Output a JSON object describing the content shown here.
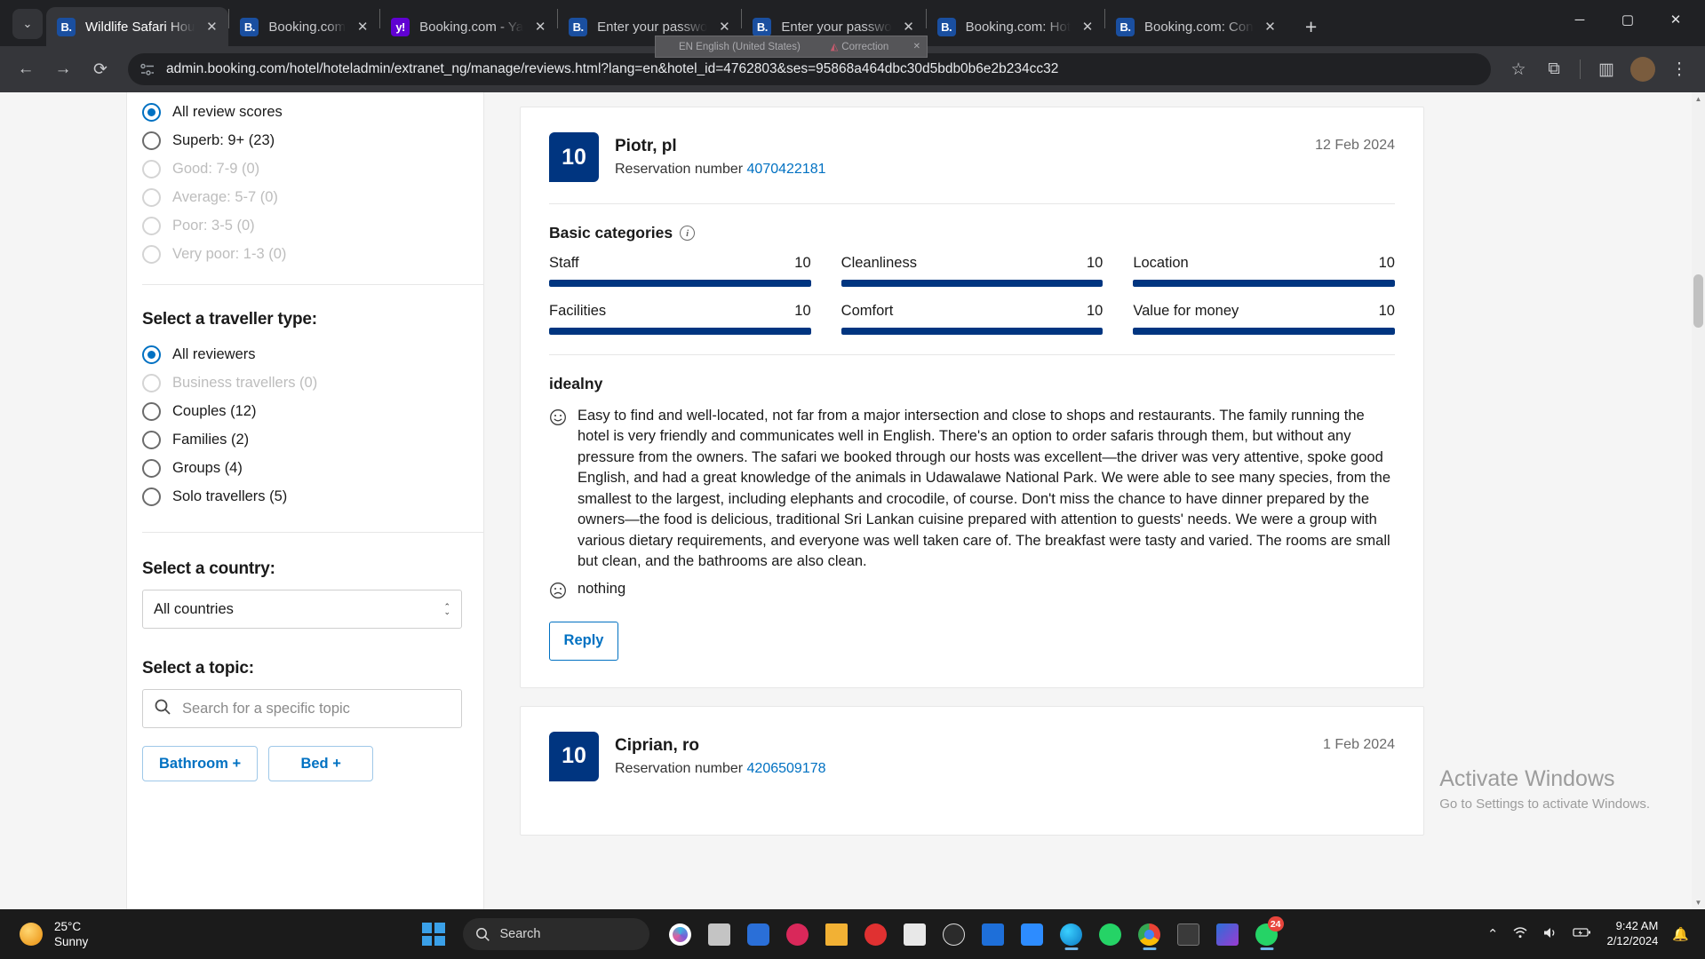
{
  "browser": {
    "tabs": [
      {
        "title": "Wildlife Safari Hou",
        "favicon": "B.",
        "active": true
      },
      {
        "title": "Booking.com",
        "favicon": "B.",
        "active": false
      },
      {
        "title": "Booking.com - Ya",
        "favicon": "y!",
        "active": false,
        "brand": "yahoo"
      },
      {
        "title": "Enter your passwo",
        "favicon": "B.",
        "active": false
      },
      {
        "title": "Enter your passwo",
        "favicon": "B.",
        "active": false
      },
      {
        "title": "Booking.com: Hot",
        "favicon": "B.",
        "active": false
      },
      {
        "title": "Booking.com: Con",
        "favicon": "B.",
        "active": false
      }
    ],
    "new_tab_label": "+",
    "tab_list_label": "⌄",
    "window_controls": {
      "minimize": "─",
      "maximize": "▢",
      "close": "✕"
    },
    "nav": {
      "back": "←",
      "forward": "→",
      "reload": "⟳"
    },
    "url": "admin.booking.com/hotel/hoteladmin/extranet_ng/manage/reviews.html?lang=en&hotel_id=4762803&ses=95868a464dbc30d5bdb0b6e2b234cc32",
    "bookmark_icon": "☆",
    "extensions_icon": "⧉",
    "sidepanel_icon": "▥",
    "profile_initial": "",
    "menu_icon": "⋮"
  },
  "ime_popup": {
    "language": "EN English (United States)",
    "correction": "Correction",
    "close": "✕"
  },
  "sidebar": {
    "review_scores": {
      "options": [
        {
          "label": "All review scores",
          "checked": true,
          "disabled": false
        },
        {
          "label": "Superb: 9+ (23)",
          "checked": false,
          "disabled": false
        },
        {
          "label": "Good: 7-9 (0)",
          "checked": false,
          "disabled": true
        },
        {
          "label": "Average: 5-7 (0)",
          "checked": false,
          "disabled": true
        },
        {
          "label": "Poor: 3-5 (0)",
          "checked": false,
          "disabled": true
        },
        {
          "label": "Very poor: 1-3 (0)",
          "checked": false,
          "disabled": true
        }
      ]
    },
    "traveller_type": {
      "title": "Select a traveller type:",
      "options": [
        {
          "label": "All reviewers",
          "checked": true,
          "disabled": false
        },
        {
          "label": "Business travellers (0)",
          "checked": false,
          "disabled": true
        },
        {
          "label": "Couples (12)",
          "checked": false,
          "disabled": false
        },
        {
          "label": "Families (2)",
          "checked": false,
          "disabled": false
        },
        {
          "label": "Groups (4)",
          "checked": false,
          "disabled": false
        },
        {
          "label": "Solo travellers (5)",
          "checked": false,
          "disabled": false
        }
      ]
    },
    "country": {
      "title": "Select a country:",
      "selected": "All countries"
    },
    "topic": {
      "title": "Select a topic:",
      "search_placeholder": "Search for a specific topic",
      "chips": [
        "Bathroom +",
        "Bed +"
      ]
    }
  },
  "reviews": [
    {
      "score": "10",
      "name": "Piotr, pl",
      "reservation_label": "Reservation number",
      "reservation_number": "4070422181",
      "date": "12 Feb 2024",
      "categories_title": "Basic categories",
      "categories": [
        {
          "name": "Staff",
          "value": "10",
          "pct": 100
        },
        {
          "name": "Cleanliness",
          "value": "10",
          "pct": 100
        },
        {
          "name": "Location",
          "value": "10",
          "pct": 100
        },
        {
          "name": "Facilities",
          "value": "10",
          "pct": 100
        },
        {
          "name": "Comfort",
          "value": "10",
          "pct": 100
        },
        {
          "name": "Value for money",
          "value": "10",
          "pct": 100
        }
      ],
      "title": "idealny",
      "positive": "Easy to find and well-located, not far from a major intersection and close to shops and restaurants. The family running the hotel is very friendly and communicates well in English. There's an option to order safaris through them, but without any pressure from the owners. The safari we booked through our hosts was excellent—the driver was very attentive, spoke good English, and had a great knowledge of the animals in Udawalawe National Park. We were able to see many species, from the smallest to the largest, including elephants and crocodile, of course. Don't miss the chance to have dinner prepared by the owners—the food is delicious, traditional Sri Lankan cuisine prepared with attention to guests' needs. We were a group with various dietary requirements, and everyone was well taken care of. The breakfast were tasty and varied. The rooms are small but clean, and the bathrooms are also clean.",
      "negative": "nothing",
      "reply_label": "Reply"
    },
    {
      "score": "10",
      "name": "Ciprian, ro",
      "reservation_label": "Reservation number",
      "reservation_number": "4206509178",
      "date": "1 Feb 2024"
    }
  ],
  "watermark": {
    "line1": "Activate Windows",
    "line2": "Go to Settings to activate Windows."
  },
  "taskbar": {
    "weather": {
      "temperature": "25°C",
      "condition": "Sunny"
    },
    "search_placeholder": "Search",
    "whatsapp_badge": "24",
    "clock": {
      "time": "9:42 AM",
      "date": "2/12/2024"
    },
    "tray": {
      "chevron": "⌃",
      "wifi": "wifi-icon",
      "volume": "volume-icon",
      "battery": "battery-icon",
      "notifications": "🔔"
    }
  }
}
